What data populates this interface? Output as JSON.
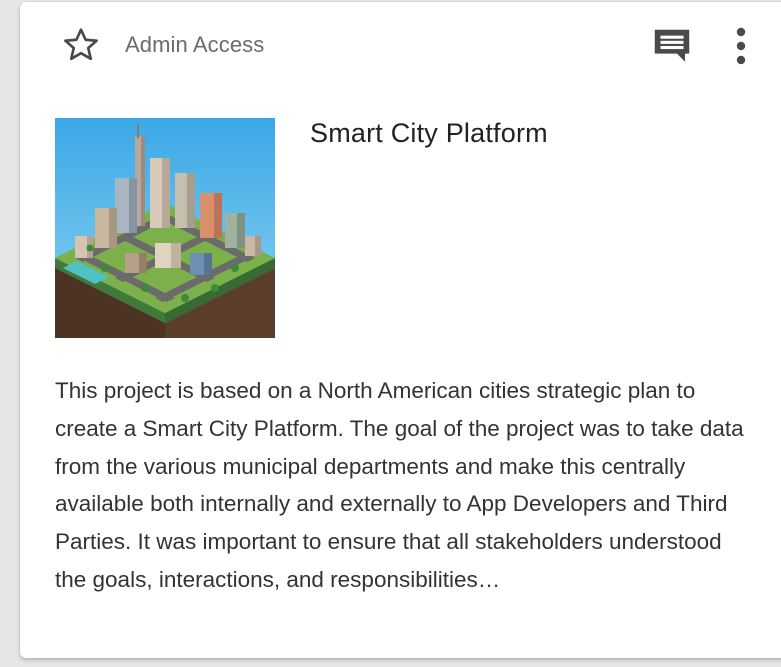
{
  "card": {
    "access_label": "Admin Access",
    "title": "Smart City Platform",
    "description": "This project is based on a North American cities strategic plan to create a Smart City Platform. The goal of the project was to take data from the various municipal departments and make this centrally available both internally and externally to App Developers and Third Parties. It was important to ensure that all stakeholders understood the goals, interactions, and responsibilities…",
    "icons": {
      "favorite": "star-outline-icon",
      "comments": "comment-icon",
      "menu": "more-vert-icon"
    },
    "thumbnail": "isometric-city-illustration"
  },
  "colors": {
    "icon": "#4a4a4a",
    "sky": "#4fb4e8",
    "ground": "#5a3d2b"
  }
}
